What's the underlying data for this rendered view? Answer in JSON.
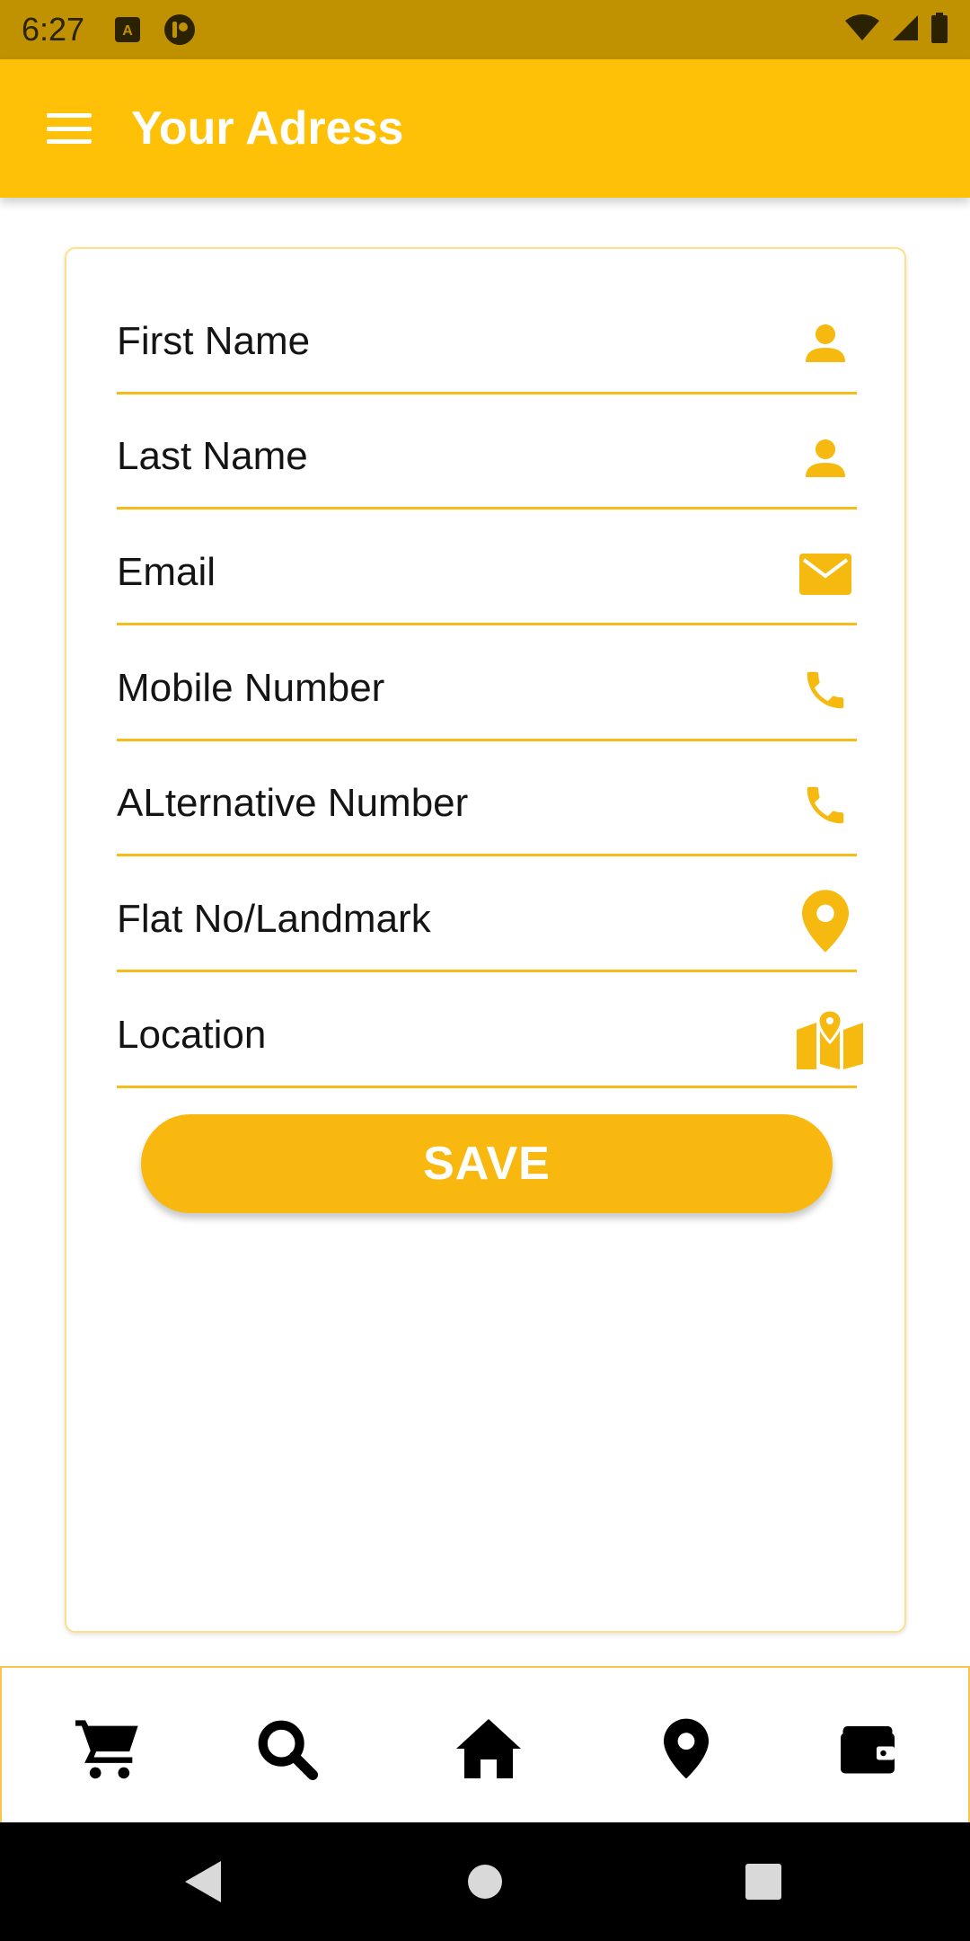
{
  "status_bar": {
    "time": "6:27",
    "icons": [
      "a-notification-icon",
      "app-notification-icon",
      "wifi-icon",
      "signal-icon",
      "battery-icon"
    ]
  },
  "app_bar": {
    "title": "Your Adress",
    "menu_icon": "menu-icon"
  },
  "form": {
    "fields": [
      {
        "label": "First Name",
        "icon": "person-icon"
      },
      {
        "label": "Last Name",
        "icon": "person-icon"
      },
      {
        "label": "Email",
        "icon": "mail-icon"
      },
      {
        "label": "Mobile Number",
        "icon": "phone-icon"
      },
      {
        "label": "ALternative Number",
        "icon": "phone-icon"
      },
      {
        "label": "Flat No/Landmark",
        "icon": "location-pin-icon"
      },
      {
        "label": "Location",
        "icon": "map-icon"
      }
    ],
    "save_label": "SAVE"
  },
  "bottom_nav": {
    "items": [
      "cart-icon",
      "search-icon",
      "home-icon",
      "location-pin-icon",
      "wallet-icon"
    ]
  },
  "system_nav": {
    "items": [
      "back-icon",
      "home-circle-icon",
      "recents-icon"
    ]
  },
  "colors": {
    "status_bar": "#C09100",
    "app_bar": "#FFC107",
    "accent": "#F9B80F",
    "field_underline": "#F5BC1A",
    "icon": "#F5B90F"
  }
}
